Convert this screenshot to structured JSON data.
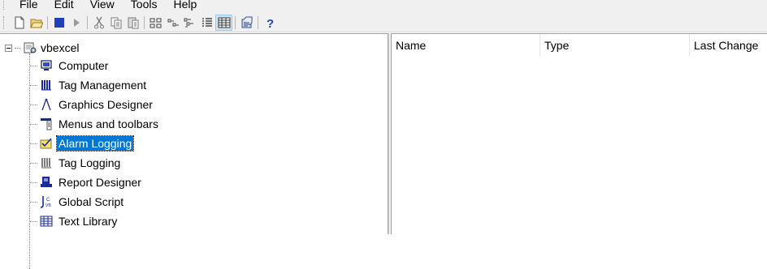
{
  "menubar": {
    "items": [
      "File",
      "Edit",
      "View",
      "Tools",
      "Help"
    ]
  },
  "toolbar": {
    "buttons": [
      {
        "icon": "new-document-icon",
        "enabled": true
      },
      {
        "icon": "open-folder-icon",
        "enabled": true
      },
      {
        "icon": "stop-icon",
        "enabled": true
      },
      {
        "icon": "play-icon",
        "enabled": false
      },
      {
        "icon": "cut-icon",
        "enabled": false
      },
      {
        "icon": "copy-icon",
        "enabled": false
      },
      {
        "icon": "paste-icon",
        "enabled": false
      },
      {
        "icon": "large-icons-view-icon",
        "enabled": true
      },
      {
        "icon": "small-icons-view-icon",
        "enabled": true
      },
      {
        "icon": "list-view-icon",
        "enabled": true
      },
      {
        "icon": "details-view-icon",
        "enabled": true
      },
      {
        "icon": "details-grid-view-icon",
        "enabled": true,
        "pressed": true
      },
      {
        "icon": "properties-icon",
        "enabled": true
      },
      {
        "icon": "help-icon",
        "enabled": true
      }
    ]
  },
  "tree": {
    "root": {
      "label": "vbexcel",
      "icon": "project-icon",
      "expanded": true
    },
    "items": [
      {
        "label": "Computer",
        "icon": "computer-icon"
      },
      {
        "label": "Tag Management",
        "icon": "tag-management-icon"
      },
      {
        "label": "Graphics Designer",
        "icon": "graphics-designer-icon"
      },
      {
        "label": "Menus and toolbars",
        "icon": "menus-toolbars-icon"
      },
      {
        "label": "Alarm Logging",
        "icon": "alarm-logging-icon",
        "selected": true
      },
      {
        "label": "Tag Logging",
        "icon": "tag-logging-icon"
      },
      {
        "label": "Report Designer",
        "icon": "report-designer-icon"
      },
      {
        "label": "Global Script",
        "icon": "global-script-icon"
      },
      {
        "label": "Text Library",
        "icon": "text-library-icon"
      }
    ]
  },
  "list": {
    "columns": [
      "Name",
      "Type",
      "Last Change"
    ]
  },
  "colors": {
    "selection": "#0078d7",
    "toolbar_bg": "#f0f0f0"
  }
}
